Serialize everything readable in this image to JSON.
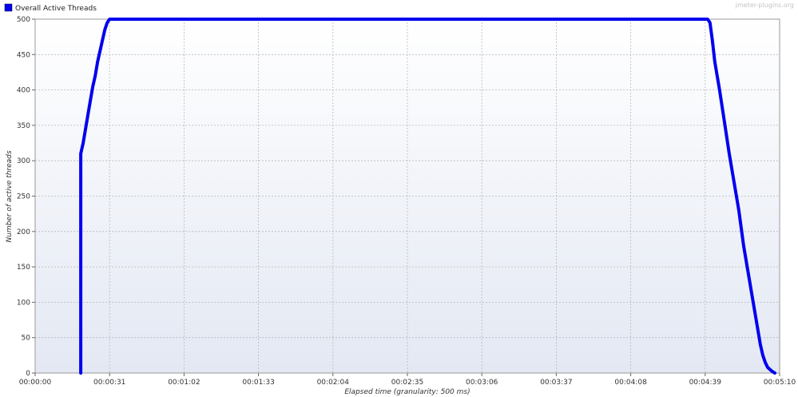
{
  "chart_data": {
    "type": "line",
    "xlabel": "Elapsed time (granularity: 500 ms)",
    "ylabel": "Number of active threads",
    "watermark": "jmeter-plugins.org",
    "grid": true,
    "legend_position": "top-left",
    "xlim_seconds": [
      0,
      310
    ],
    "ylim": [
      0,
      500
    ],
    "x_ticks": [
      "00:00:00",
      "00:00:31",
      "00:01:02",
      "00:01:33",
      "00:02:04",
      "00:02:35",
      "00:03:06",
      "00:03:37",
      "00:04:08",
      "00:04:39",
      "00:05:10"
    ],
    "y_ticks": [
      0,
      50,
      100,
      150,
      200,
      250,
      300,
      350,
      400,
      450,
      500
    ],
    "series": [
      {
        "name": "Overall Active Threads",
        "color": "#0000ee",
        "x": [
          "00:00:19",
          "00:00:19",
          "00:00:20",
          "00:00:21",
          "00:00:22",
          "00:00:23",
          "00:00:24",
          "00:00:25",
          "00:00:26",
          "00:00:27",
          "00:00:28",
          "00:00:29",
          "00:00:30",
          "00:00:31",
          "00:01:00",
          "00:02:00",
          "00:03:00",
          "00:04:00",
          "00:04:40",
          "00:04:41",
          "00:04:42",
          "00:04:43",
          "00:04:45",
          "00:04:47",
          "00:04:49",
          "00:04:51",
          "00:04:53",
          "00:04:55",
          "00:04:57",
          "00:04:59",
          "00:05:01",
          "00:05:02",
          "00:05:03",
          "00:05:04",
          "00:05:05",
          "00:05:06",
          "00:05:07",
          "00:05:08"
        ],
        "values": [
          0,
          310,
          325,
          345,
          365,
          385,
          405,
          420,
          440,
          455,
          470,
          485,
          495,
          500,
          500,
          500,
          500,
          500,
          500,
          495,
          470,
          440,
          400,
          355,
          310,
          270,
          230,
          180,
          140,
          100,
          60,
          40,
          25,
          15,
          8,
          5,
          2,
          0
        ]
      }
    ]
  }
}
